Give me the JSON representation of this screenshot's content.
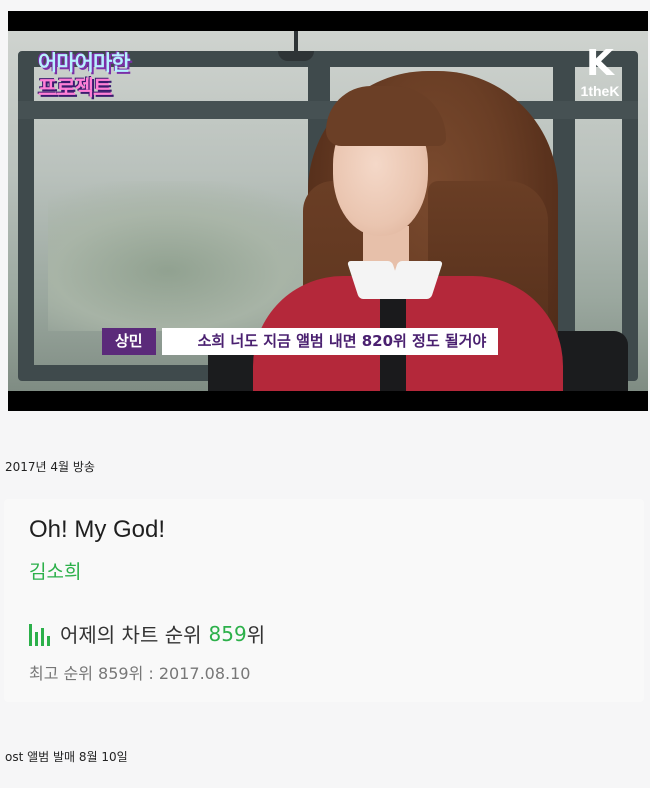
{
  "video": {
    "show_logo_line1": "어마어마한",
    "show_logo_line2": "프로젝트",
    "channel_logo_mark": "K",
    "channel_logo_name": "1theK",
    "subtitle_speaker": "상민",
    "subtitle_text": "소희 너도 지금 앨범 내면 820위 정도 될거야"
  },
  "caption_top": "2017년 4월 방송",
  "song_card": {
    "title": "Oh! My God!",
    "artist": "김소희",
    "chart_label": "어제의 차트 순위",
    "chart_rank": "859",
    "chart_rank_suffix": "위",
    "peak_text": "최고 순위 859위 : 2017.08.10",
    "accent_color": "#2cb04a",
    "chart_icon": "chart-bars-icon"
  },
  "caption_bottom": "ost 앨범 발매 8월 10일"
}
